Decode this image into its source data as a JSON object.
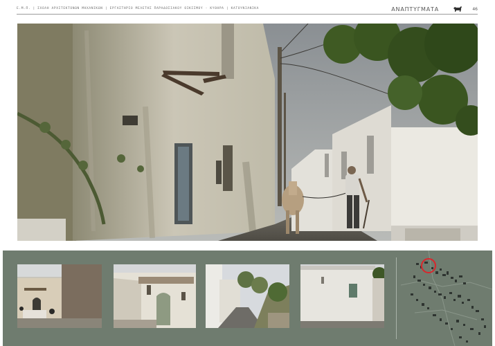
{
  "header": {
    "breadcrumb": "Ε.Μ.Π. | ΣΧΟΛΗ ΑΡΧΙΤΕΚΤΟΝΩΝ ΜΗΧΑΝΙΚΩΝ | ΕΡΓΑΣΤΗΡΙΟ ΜΕΛΕΤΗΣ ΠΑΡΑΔΟΣΙΑΚΟΥ ΟΙΚΙΣΜΟΥ - ΚΥΘΗΡΑ | ΚΑΤΟΥΝΙΑΝΙΚΑ",
    "section_title": "ΑΝΑΠΤΥΓΜΑΤΑ",
    "page_number": "46",
    "logo_icon": "goat-icon"
  },
  "colors": {
    "panel_background": "#6f7c6f",
    "map_highlight": "#d9262c",
    "header_rule": "#9a9a9a"
  },
  "thumbnails": [
    "thumbnail-1",
    "thumbnail-2",
    "thumbnail-3",
    "thumbnail-4"
  ],
  "map": {
    "icon": "location-highlight-circle"
  }
}
